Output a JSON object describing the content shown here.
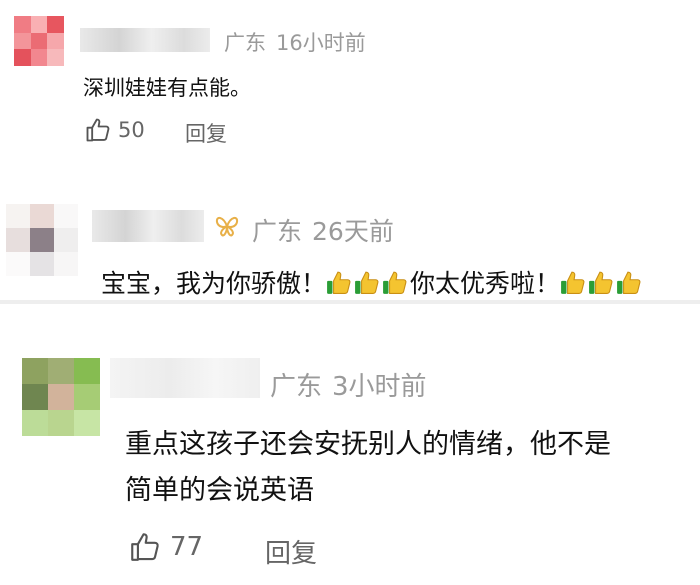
{
  "comments": [
    {
      "location": "广东",
      "time": "16小时前",
      "text": "深圳娃娃有点能。",
      "likes": "50",
      "reply_label": "回复",
      "avatar_colors": [
        "#f07c84",
        "#f9b0b3",
        "#e7565f",
        "#f3959a",
        "#eb6c74",
        "#f6a7ab",
        "#e4525c",
        "#f2878f",
        "#f7b9bb"
      ]
    },
    {
      "location": "广东",
      "time": "26天前",
      "text_segments": [
        "宝宝，我为你骄傲！",
        "你太优秀啦！"
      ],
      "emoji_name": "thumbs-up-emoji",
      "badge_icon": "butterfly-icon",
      "avatar_colors": [
        "#f6f3f1",
        "#ead9d5",
        "#f9f8f8",
        "#e7dedd",
        "#8c8088",
        "#efeeee",
        "#fbfafa",
        "#e5e3e5",
        "#f7f6f6"
      ]
    },
    {
      "location": "广东",
      "time": "3小时前",
      "text_lines": [
        "重点这孩子还会安抚别人的情绪，他不是",
        "简单的会说英语"
      ],
      "likes": "77",
      "reply_label": "回复",
      "avatar_colors": [
        "#8ea260",
        "#a0ae74",
        "#86bc51",
        "#6f8650",
        "#d2b39b",
        "#a6cc75",
        "#bcdc98",
        "#b9d58f",
        "#c7e5a5"
      ]
    }
  ],
  "colors": {
    "meta_gray": "#9a9a9a",
    "action_gray": "#666666",
    "badge_gold": "#e8b048",
    "divider": "#eeeeee"
  }
}
